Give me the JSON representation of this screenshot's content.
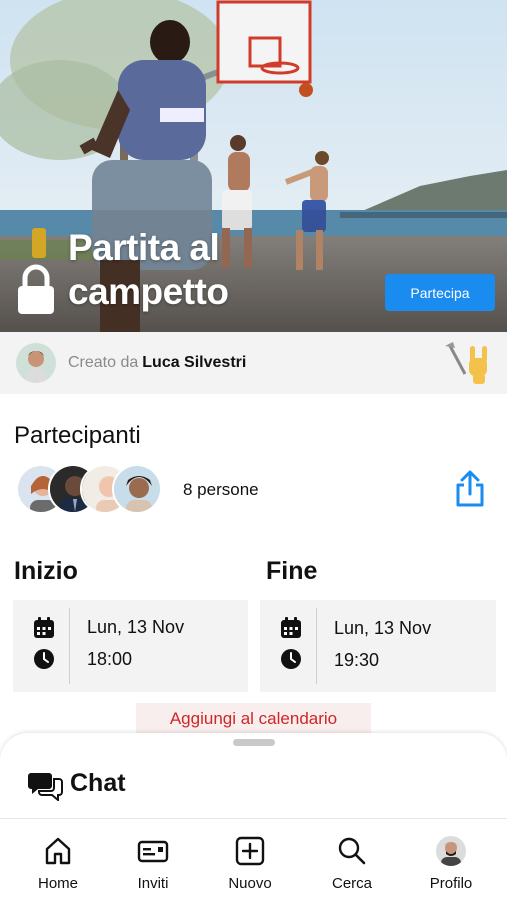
{
  "event": {
    "title_line1": "Partita al",
    "title_line2": "campetto",
    "join_label": "Partecipa"
  },
  "creator": {
    "prefix": "Creato da",
    "name": "Luca Silvestri"
  },
  "participants": {
    "title": "Partecipanti",
    "count_label": "8 persone"
  },
  "schedule": {
    "start_title": "Inizio",
    "start_date": "Lun, 13 Nov",
    "start_time": "18:00",
    "end_title": "Fine",
    "end_date": "Lun, 13 Nov",
    "end_time": "19:30",
    "add_calendar_label": "Aggiungi al calendario"
  },
  "chat": {
    "label": "Chat"
  },
  "tabbar": {
    "items": [
      {
        "label": "Home",
        "icon": "home-icon"
      },
      {
        "label": "Inviti",
        "icon": "ticket-icon"
      },
      {
        "label": "Nuovo",
        "icon": "plus-square-icon"
      },
      {
        "label": "Cerca",
        "icon": "search-icon"
      },
      {
        "label": "Profilo",
        "icon": "profile-avatar"
      }
    ]
  },
  "colors": {
    "accent": "#1a8cf0",
    "danger": "#d02626",
    "panel": "#f3f3f3"
  }
}
